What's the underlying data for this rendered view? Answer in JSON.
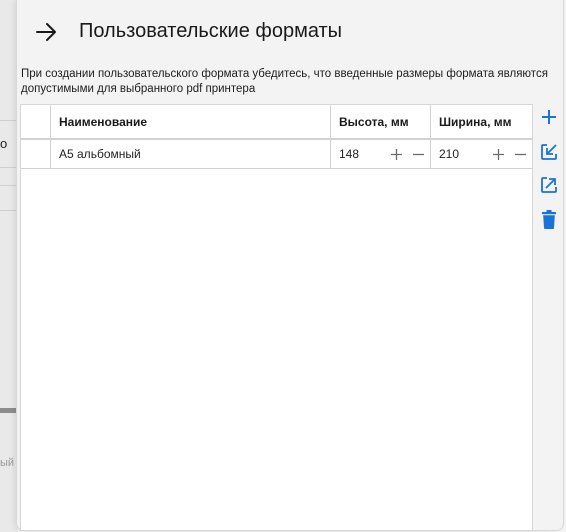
{
  "background": {
    "fragment_text": "о",
    "faded_text": "ый"
  },
  "header": {
    "back_icon": "arrow-right-icon",
    "title": "Пользовательские форматы"
  },
  "hint": "При создании пользовательского формата убедитесь, что введенные размеры формата являются допустимыми для выбранного pdf принтера",
  "table": {
    "columns": [
      "",
      "Наименование",
      "Высота, мм",
      "Ширина, мм"
    ],
    "rows": [
      {
        "name": "А5 альбомный",
        "height": "148",
        "width": "210"
      }
    ]
  },
  "toolbar": {
    "icons": [
      "plus-icon",
      "import-icon",
      "export-icon",
      "trash-icon"
    ],
    "accent": "#1a73d9"
  }
}
